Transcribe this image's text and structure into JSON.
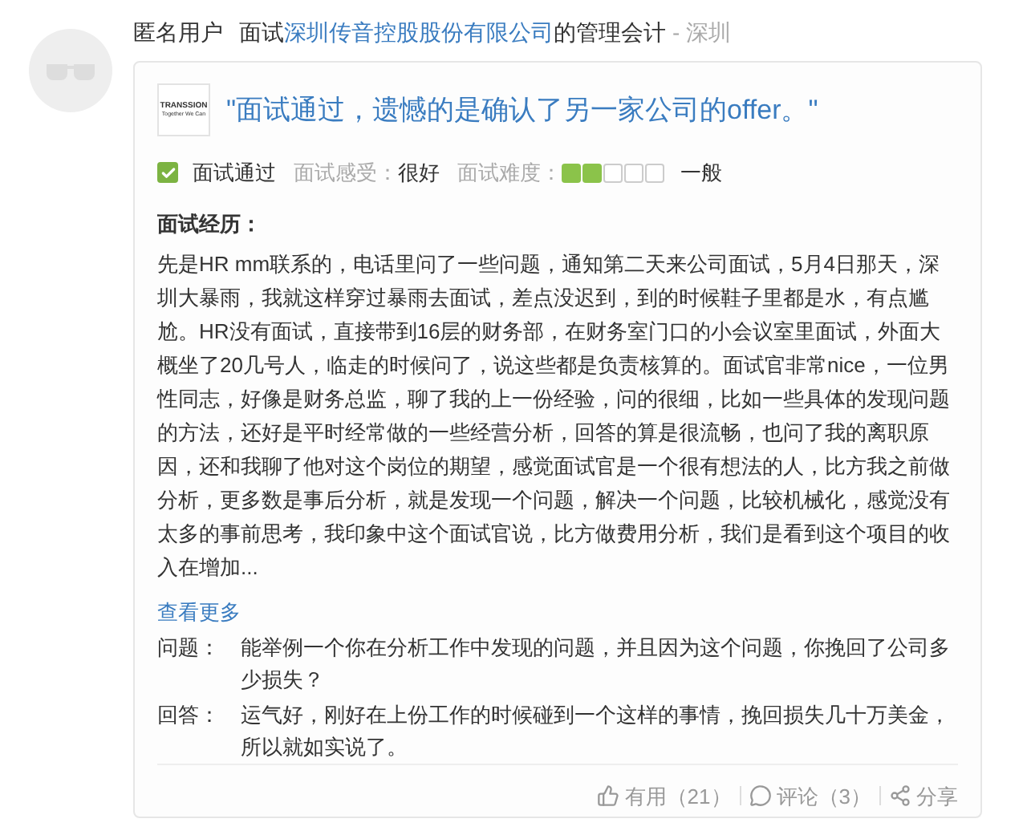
{
  "header": {
    "user": "匿名用户",
    "prefix": "面试",
    "company": "深圳传音控股股份有限公司",
    "suffix": "的管理会计",
    "separator": "-",
    "city": "深圳"
  },
  "card": {
    "logo": {
      "name": "TRANSSION",
      "tagline": "Together We Can"
    },
    "title": "\"面试通过，遗憾的是确认了另一家公司的offer。\"",
    "result": {
      "label": "面试通过",
      "checked": true
    },
    "feeling": {
      "label": "面试感受：",
      "value": "很好"
    },
    "difficulty": {
      "label": "面试难度：",
      "stars": 2,
      "value": "一般"
    },
    "experience_title": "面试经历：",
    "experience": "先是HR mm联系的，电话里问了一些问题，通知第二天来公司面试，5月4日那天，深圳大暴雨，我就这样穿过暴雨去面试，差点没迟到，到的时候鞋子里都是水，有点尴尬。HR没有面试，直接带到16层的财务部，在财务室门口的小会议室里面试，外面大概坐了20几号人，临走的时候问了，说这些都是负责核算的。面试官非常nice，一位男性同志，好像是财务总监，聊了我的上一份经验，问的很细，比如一些具体的发现问题的方法，还好是平时经常做的一些经营分析，回答的算是很流畅，也问了我的离职原因，还和我聊了他对这个岗位的期望，感觉面试官是一个很有想法的人，比方我之前做分析，更多数是事后分析，就是发现一个问题，解决一个问题，比较机械化，感觉没有太多的事前思考，我印象中这个面试官说，比方做费用分析，我们是看到这个项目的收入在增加...",
    "more": "查看更多",
    "qa": [
      {
        "label": "问题：",
        "text": "能举例一个你在分析工作中发现的问题，并且因为这个问题，你挽回了公司多少损失？"
      },
      {
        "label": "回答：",
        "text": "运气好，刚好在上份工作的时候碰到一个这样的事情，挽回损失几十万美金，所以就如实说了。"
      }
    ],
    "actions": [
      {
        "kind": "like",
        "label": "有用（21）"
      },
      {
        "kind": "comment",
        "label": "评论（3）"
      },
      {
        "kind": "share",
        "label": "分享"
      }
    ]
  }
}
